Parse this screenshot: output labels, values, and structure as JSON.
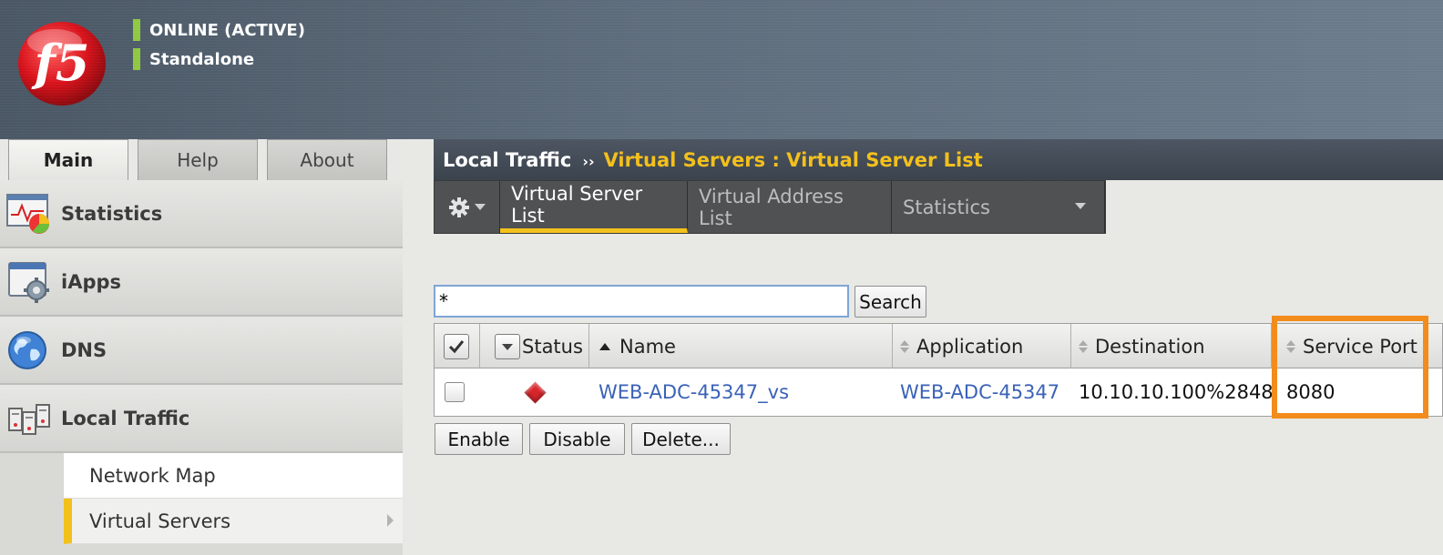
{
  "header": {
    "status_active": "ONLINE (ACTIVE)",
    "status_mode": "Standalone",
    "logo_text": "f5"
  },
  "left_tabs": [
    "Main",
    "Help",
    "About"
  ],
  "sidebar": {
    "items": [
      {
        "label": "Statistics",
        "icon": "statistics-chart-icon"
      },
      {
        "label": "iApps",
        "icon": "iapps-gear-icon"
      },
      {
        "label": "DNS",
        "icon": "dns-globe-icon"
      },
      {
        "label": "Local Traffic",
        "icon": "local-traffic-servers-icon"
      }
    ],
    "sub_items": [
      {
        "label": "Network Map",
        "active": false
      },
      {
        "label": "Virtual Servers",
        "active": true
      }
    ]
  },
  "breadcrumb": {
    "section": "Local Traffic",
    "separator": "››",
    "page": "Virtual Servers : Virtual Server List"
  },
  "sub_tabs": {
    "items": [
      "Virtual Server List",
      "Virtual Address List",
      "Statistics"
    ],
    "active": "Virtual Server List"
  },
  "search": {
    "value": "*",
    "button": "Search"
  },
  "table": {
    "columns": [
      "Status",
      "Name",
      "Application",
      "Destination",
      "Service Port"
    ],
    "rows": [
      {
        "status": "offline",
        "name": "WEB-ADC-45347_vs",
        "application": "WEB-ADC-45347",
        "destination": "10.10.10.100%2848",
        "service_port": "8080"
      }
    ]
  },
  "actions": [
    "Enable",
    "Disable",
    "Delete..."
  ],
  "colors": {
    "accent": "#f2c11c",
    "highlight": "#f28c1c",
    "status_ok": "#8fc840",
    "status_offline": "#d8262b",
    "link": "#3a62b7"
  }
}
